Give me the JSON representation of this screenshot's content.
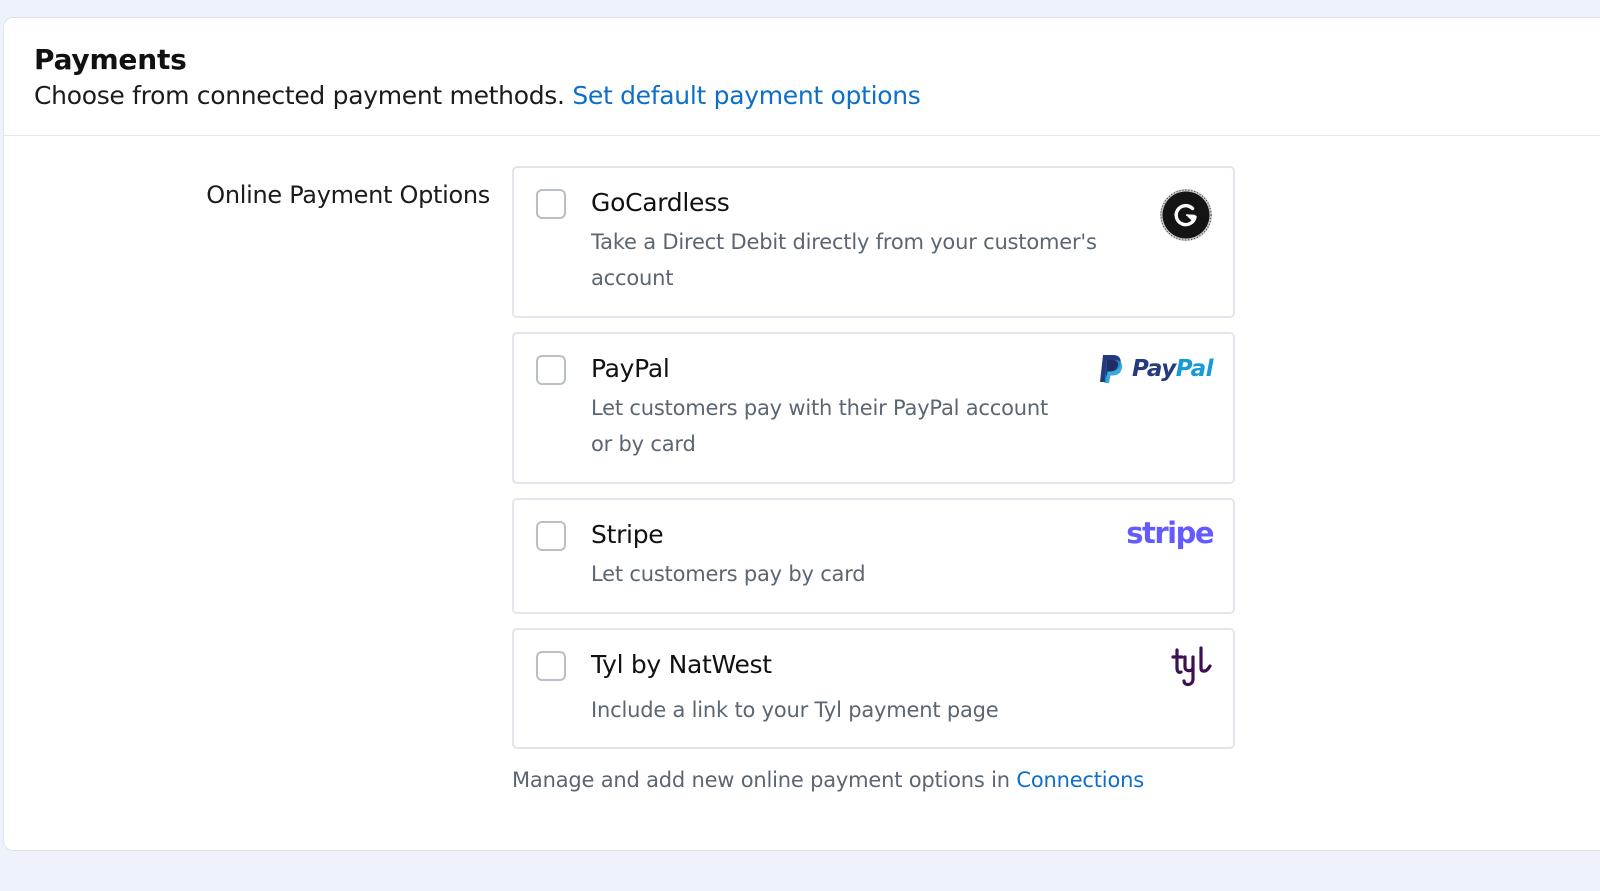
{
  "header": {
    "title": "Payments",
    "description": "Choose from connected payment methods.",
    "default_link": "Set default payment options"
  },
  "section": {
    "label": "Online Payment Options"
  },
  "options": [
    {
      "name": "GoCardless",
      "description": "Take a Direct Debit directly from your customer's account",
      "checked": false,
      "logo_icon": "gocardless-logo"
    },
    {
      "name": "PayPal",
      "description": "Let customers pay with their PayPal account or by card",
      "checked": false,
      "logo_icon": "paypal-logo",
      "logo_text_a": "Pay",
      "logo_text_b": "Pal"
    },
    {
      "name": "Stripe",
      "description": "Let customers pay by card",
      "checked": false,
      "logo_icon": "stripe-logo",
      "logo_text": "stripe"
    },
    {
      "name": "Tyl by NatWest",
      "description": "Include a link to your Tyl payment page",
      "checked": false,
      "logo_icon": "tyl-logo"
    }
  ],
  "footer": {
    "note": "Manage and add new online payment options in",
    "link": "Connections"
  },
  "colors": {
    "link": "#0d6fc9",
    "paypal_dark": "#253b80",
    "paypal_light": "#179bd7",
    "stripe": "#635bff",
    "tyl": "#3c1053"
  }
}
